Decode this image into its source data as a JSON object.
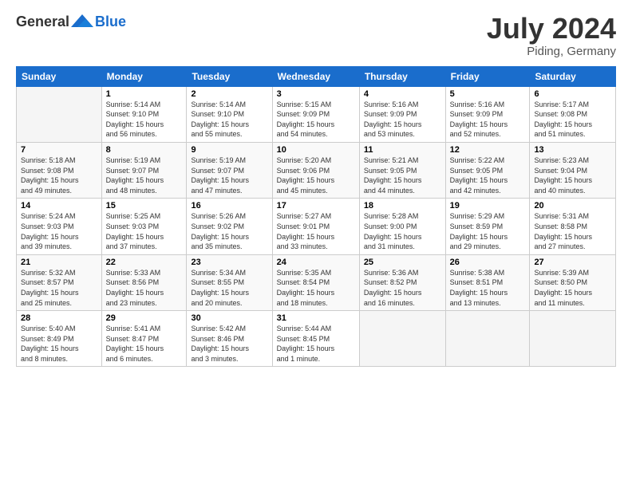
{
  "logo": {
    "text_general": "General",
    "text_blue": "Blue"
  },
  "title": {
    "month_year": "July 2024",
    "location": "Piding, Germany"
  },
  "days_of_week": [
    "Sunday",
    "Monday",
    "Tuesday",
    "Wednesday",
    "Thursday",
    "Friday",
    "Saturday"
  ],
  "weeks": [
    [
      {
        "day": "",
        "info": ""
      },
      {
        "day": "1",
        "info": "Sunrise: 5:14 AM\nSunset: 9:10 PM\nDaylight: 15 hours\nand 56 minutes."
      },
      {
        "day": "2",
        "info": "Sunrise: 5:14 AM\nSunset: 9:10 PM\nDaylight: 15 hours\nand 55 minutes."
      },
      {
        "day": "3",
        "info": "Sunrise: 5:15 AM\nSunset: 9:09 PM\nDaylight: 15 hours\nand 54 minutes."
      },
      {
        "day": "4",
        "info": "Sunrise: 5:16 AM\nSunset: 9:09 PM\nDaylight: 15 hours\nand 53 minutes."
      },
      {
        "day": "5",
        "info": "Sunrise: 5:16 AM\nSunset: 9:09 PM\nDaylight: 15 hours\nand 52 minutes."
      },
      {
        "day": "6",
        "info": "Sunrise: 5:17 AM\nSunset: 9:08 PM\nDaylight: 15 hours\nand 51 minutes."
      }
    ],
    [
      {
        "day": "7",
        "info": "Sunrise: 5:18 AM\nSunset: 9:08 PM\nDaylight: 15 hours\nand 49 minutes."
      },
      {
        "day": "8",
        "info": "Sunrise: 5:19 AM\nSunset: 9:07 PM\nDaylight: 15 hours\nand 48 minutes."
      },
      {
        "day": "9",
        "info": "Sunrise: 5:19 AM\nSunset: 9:07 PM\nDaylight: 15 hours\nand 47 minutes."
      },
      {
        "day": "10",
        "info": "Sunrise: 5:20 AM\nSunset: 9:06 PM\nDaylight: 15 hours\nand 45 minutes."
      },
      {
        "day": "11",
        "info": "Sunrise: 5:21 AM\nSunset: 9:05 PM\nDaylight: 15 hours\nand 44 minutes."
      },
      {
        "day": "12",
        "info": "Sunrise: 5:22 AM\nSunset: 9:05 PM\nDaylight: 15 hours\nand 42 minutes."
      },
      {
        "day": "13",
        "info": "Sunrise: 5:23 AM\nSunset: 9:04 PM\nDaylight: 15 hours\nand 40 minutes."
      }
    ],
    [
      {
        "day": "14",
        "info": "Sunrise: 5:24 AM\nSunset: 9:03 PM\nDaylight: 15 hours\nand 39 minutes."
      },
      {
        "day": "15",
        "info": "Sunrise: 5:25 AM\nSunset: 9:03 PM\nDaylight: 15 hours\nand 37 minutes."
      },
      {
        "day": "16",
        "info": "Sunrise: 5:26 AM\nSunset: 9:02 PM\nDaylight: 15 hours\nand 35 minutes."
      },
      {
        "day": "17",
        "info": "Sunrise: 5:27 AM\nSunset: 9:01 PM\nDaylight: 15 hours\nand 33 minutes."
      },
      {
        "day": "18",
        "info": "Sunrise: 5:28 AM\nSunset: 9:00 PM\nDaylight: 15 hours\nand 31 minutes."
      },
      {
        "day": "19",
        "info": "Sunrise: 5:29 AM\nSunset: 8:59 PM\nDaylight: 15 hours\nand 29 minutes."
      },
      {
        "day": "20",
        "info": "Sunrise: 5:31 AM\nSunset: 8:58 PM\nDaylight: 15 hours\nand 27 minutes."
      }
    ],
    [
      {
        "day": "21",
        "info": "Sunrise: 5:32 AM\nSunset: 8:57 PM\nDaylight: 15 hours\nand 25 minutes."
      },
      {
        "day": "22",
        "info": "Sunrise: 5:33 AM\nSunset: 8:56 PM\nDaylight: 15 hours\nand 23 minutes."
      },
      {
        "day": "23",
        "info": "Sunrise: 5:34 AM\nSunset: 8:55 PM\nDaylight: 15 hours\nand 20 minutes."
      },
      {
        "day": "24",
        "info": "Sunrise: 5:35 AM\nSunset: 8:54 PM\nDaylight: 15 hours\nand 18 minutes."
      },
      {
        "day": "25",
        "info": "Sunrise: 5:36 AM\nSunset: 8:52 PM\nDaylight: 15 hours\nand 16 minutes."
      },
      {
        "day": "26",
        "info": "Sunrise: 5:38 AM\nSunset: 8:51 PM\nDaylight: 15 hours\nand 13 minutes."
      },
      {
        "day": "27",
        "info": "Sunrise: 5:39 AM\nSunset: 8:50 PM\nDaylight: 15 hours\nand 11 minutes."
      }
    ],
    [
      {
        "day": "28",
        "info": "Sunrise: 5:40 AM\nSunset: 8:49 PM\nDaylight: 15 hours\nand 8 minutes."
      },
      {
        "day": "29",
        "info": "Sunrise: 5:41 AM\nSunset: 8:47 PM\nDaylight: 15 hours\nand 6 minutes."
      },
      {
        "day": "30",
        "info": "Sunrise: 5:42 AM\nSunset: 8:46 PM\nDaylight: 15 hours\nand 3 minutes."
      },
      {
        "day": "31",
        "info": "Sunrise: 5:44 AM\nSunset: 8:45 PM\nDaylight: 15 hours\nand 1 minute."
      },
      {
        "day": "",
        "info": ""
      },
      {
        "day": "",
        "info": ""
      },
      {
        "day": "",
        "info": ""
      }
    ]
  ]
}
